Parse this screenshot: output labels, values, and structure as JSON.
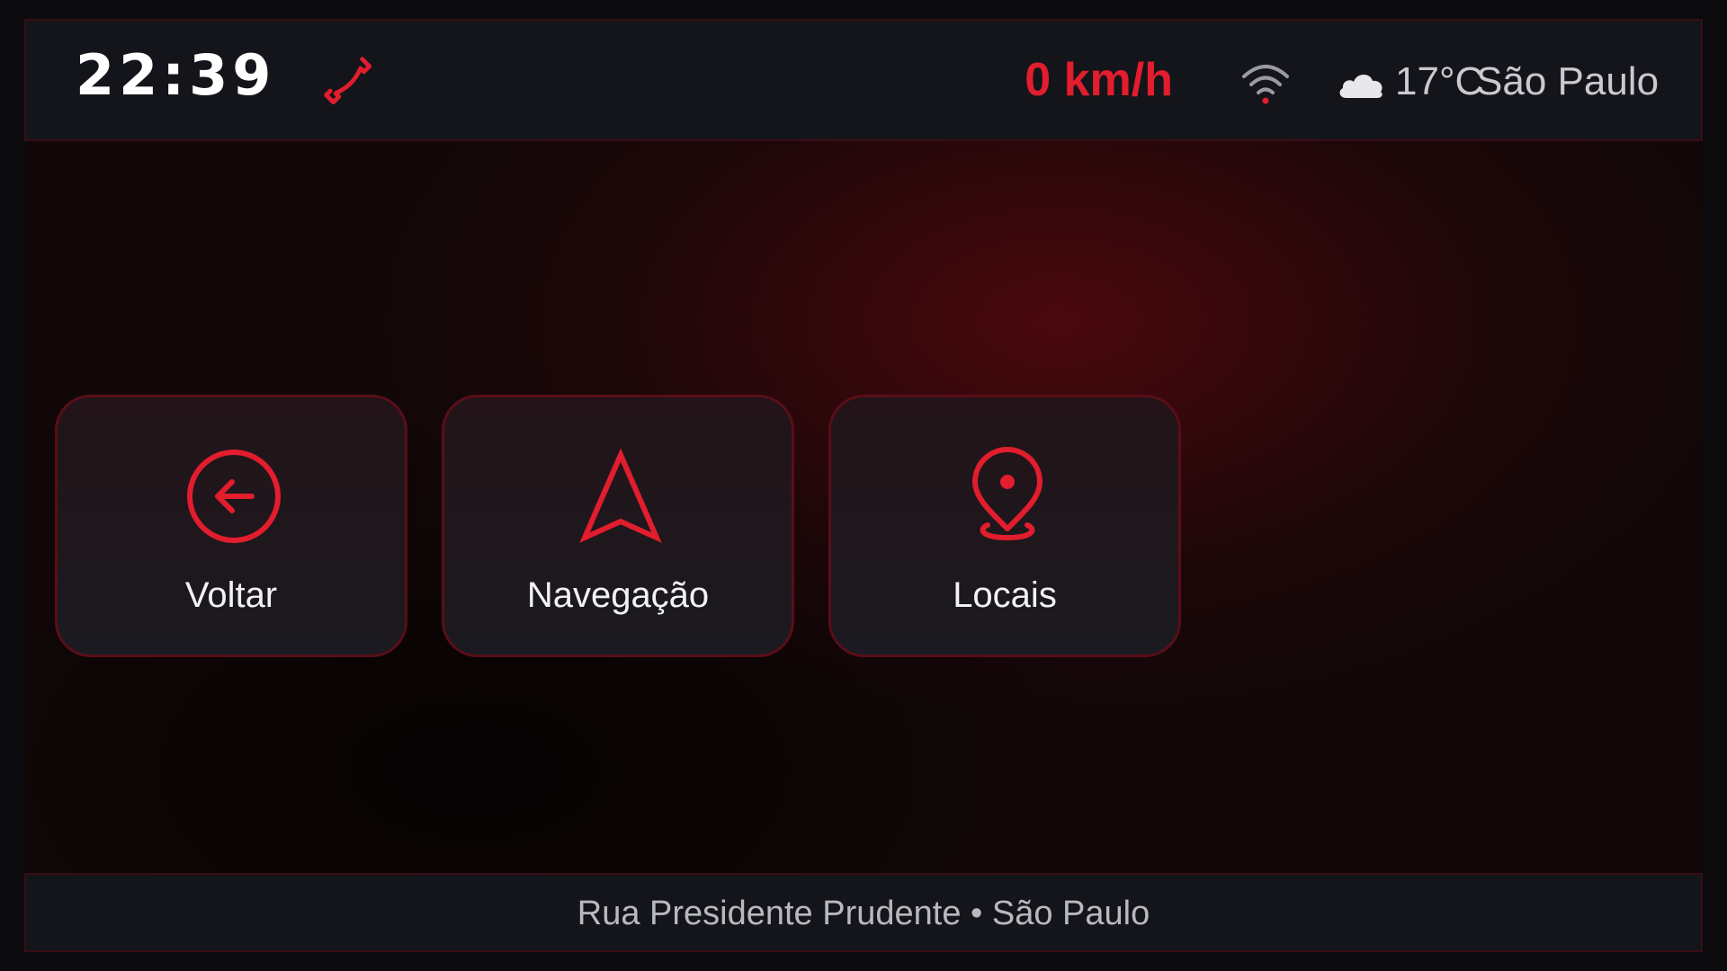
{
  "status_bar": {
    "time": "22:39",
    "phone_icon": "phone-icon",
    "speed": "0 km/h",
    "wifi_icon": "wifi-icon",
    "weather_icon": "cloud-icon",
    "temperature": "17°C",
    "city": "São Paulo"
  },
  "tiles": [
    {
      "label": "Voltar",
      "icon": "arrow-left-circle-icon"
    },
    {
      "label": "Navegação",
      "icon": "navigation-arrow-icon"
    },
    {
      "label": "Locais",
      "icon": "map-pin-icon"
    }
  ],
  "footer": {
    "address": "Rua Presidente Prudente • São Paulo"
  },
  "colors": {
    "accent": "#e11d2e",
    "bar_background": "#14151a",
    "text_primary": "#ffffff",
    "text_secondary": "#c9c9cf"
  }
}
